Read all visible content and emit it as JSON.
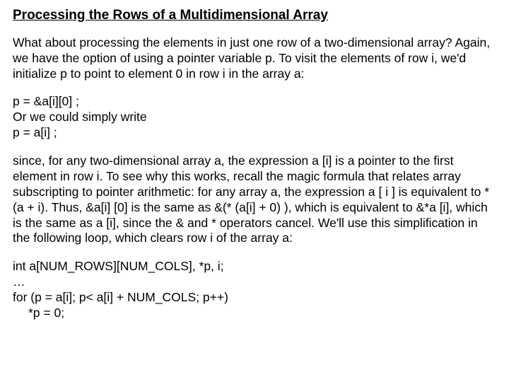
{
  "title": "Processing the Rows of a Multidimensional Array",
  "para1": "What about processing the elements in just one row of a two-dimensional array? Again, we have the option of using a pointer variable p. To visit the elements of row i, we'd initialize p to point to element 0 in row i in the array a:",
  "code1_line1": "p = &a[i][0] ;",
  "code1_line2": "Or we could simply write",
  "code1_line3": "p = a[i] ;",
  "para2": "since, for any two-dimensional array a, the expression a [i] is a pointer to the first element in row i. To see why this works, recall the magic formula that relates array subscripting to pointer arithmetic: for any array a, the expression a [ i ] is equivalent to * (a + i). Thus, &a[i] [0] is the same as &(* (a[i] + 0) ), which is equivalent to &*a [i], which is the same as a [i], since the & and * operators cancel. We'll use this simplification in the following loop, which clears row i of the array a:",
  "code2_line1": "int a[NUM_ROWS][NUM_COLS], *p, i;",
  "code2_line2": "…",
  "code2_line3": "for (p = a[i]; p< a[i] + NUM_COLS; p++)",
  "code2_line4": "*p = 0;"
}
